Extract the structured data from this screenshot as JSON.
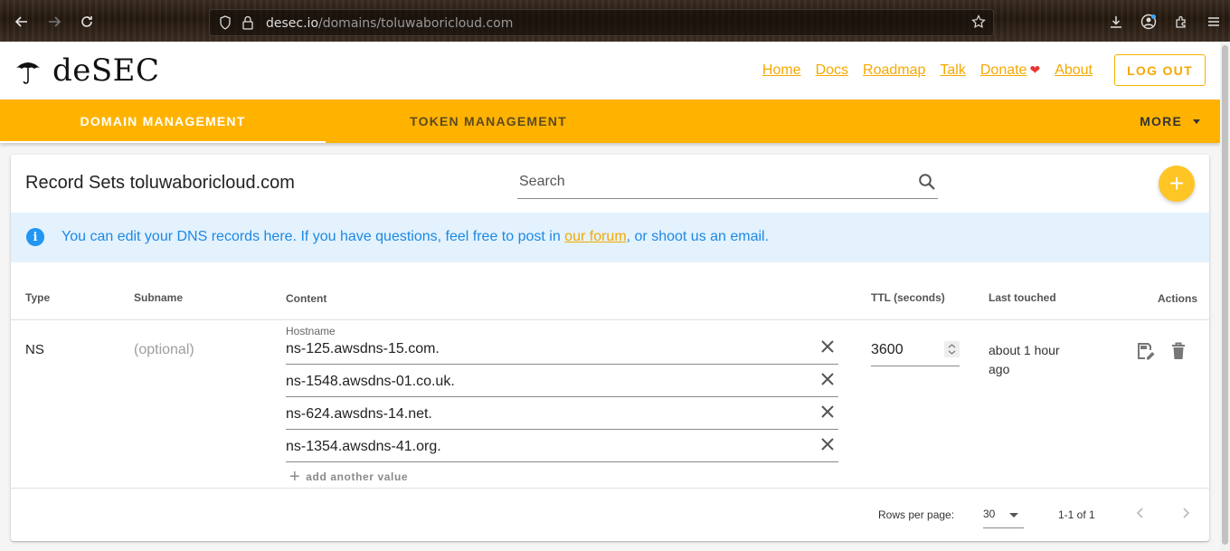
{
  "browser": {
    "url_host": "desec.io",
    "url_path": "/domains/toluwaboricloud.com"
  },
  "header": {
    "logo_text": "deSEC",
    "links": [
      "Home",
      "Docs",
      "Roadmap",
      "Talk",
      "Donate",
      "About"
    ],
    "logout_label": "LOG OUT"
  },
  "tabs": {
    "domain_management": "DOMAIN MANAGEMENT",
    "token_management": "TOKEN MANAGEMENT",
    "more": "MORE"
  },
  "card": {
    "title": "Record Sets toluwaboricloud.com",
    "search_placeholder": "Search",
    "fab_label": "+"
  },
  "info": {
    "text_before": "You can edit your DNS records here. If you have questions, feel free to post in ",
    "link_text": "our forum",
    "text_after": ", or shoot us an email."
  },
  "table": {
    "headers": {
      "type": "Type",
      "subname": "Subname",
      "content": "Content",
      "ttl": "TTL (seconds)",
      "last_touched": "Last touched",
      "actions": "Actions"
    },
    "row": {
      "type": "NS",
      "subname_placeholder": "(optional)",
      "content_label": "Hostname",
      "values": [
        "ns-125.awsdns-15.com.",
        "ns-1548.awsdns-01.co.uk.",
        "ns-624.awsdns-14.net.",
        "ns-1354.awsdns-41.org."
      ],
      "add_value_label": "add another value",
      "ttl": "3600",
      "last_touched": "about 1 hour ago"
    }
  },
  "footer": {
    "rows_per_page_label": "Rows per page:",
    "rows_per_page_value": "30",
    "page_range": "1-1 of 1"
  },
  "colors": {
    "brand_yellow": "#ffb300",
    "link_orange": "#f6a800",
    "info_blue": "#1e88e5",
    "info_bg": "#e3f2fd"
  }
}
